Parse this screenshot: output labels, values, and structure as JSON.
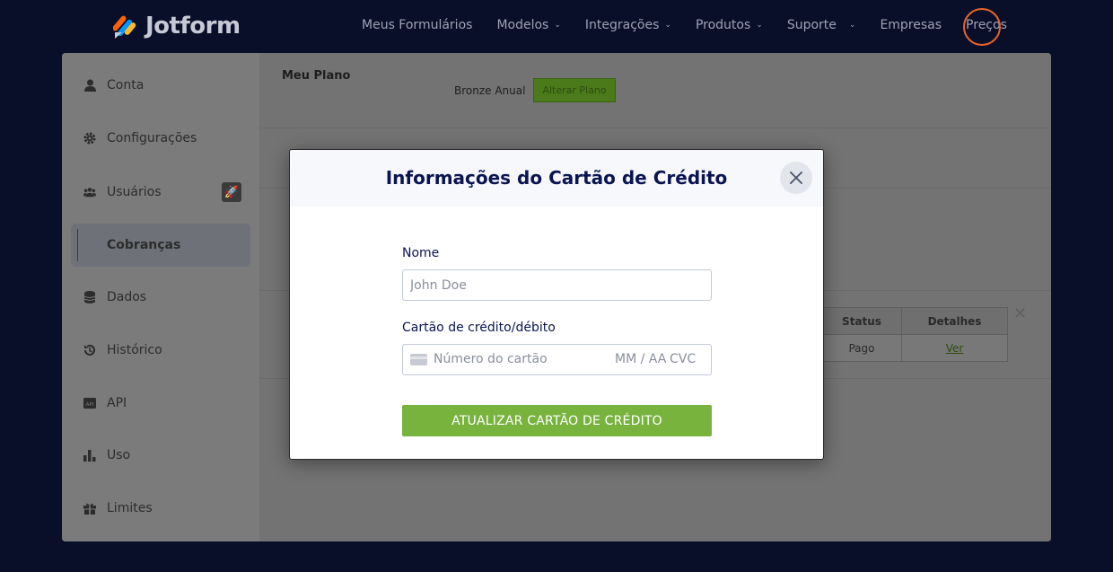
{
  "brand": {
    "name": "Jotform"
  },
  "nav": {
    "items": [
      {
        "label": "Meus Formulários",
        "has_dropdown": false
      },
      {
        "label": "Modelos",
        "has_dropdown": true
      },
      {
        "label": "Integrações",
        "has_dropdown": true
      },
      {
        "label": "Produtos",
        "has_dropdown": true
      },
      {
        "label": "Suporte",
        "has_dropdown": true
      },
      {
        "label": "Empresas",
        "has_dropdown": false
      },
      {
        "label": "Preços",
        "has_dropdown": false
      }
    ]
  },
  "sidebar": {
    "items": [
      {
        "label": "Conta",
        "icon": "user-icon"
      },
      {
        "label": "Configurações",
        "icon": "gear-icon"
      },
      {
        "label": "Usuários",
        "icon": "users-icon",
        "badge_icon": "rocket-icon"
      },
      {
        "label": "Cobranças",
        "icon": "billing-icon",
        "active": true
      },
      {
        "label": "Dados",
        "icon": "database-icon"
      },
      {
        "label": "Histórico",
        "icon": "history-icon"
      },
      {
        "label": "API",
        "icon": "api-icon"
      },
      {
        "label": "Uso",
        "icon": "bar-chart-icon"
      },
      {
        "label": "Limites",
        "icon": "gift-icon"
      }
    ]
  },
  "content": {
    "plan_label": "Meu Plano",
    "plan_value": "Bronze Anual",
    "change_plan_button": "Alterar Plano",
    "table": {
      "headers": [
        "Status",
        "Detalhes"
      ],
      "row": {
        "status": "Pago",
        "details_link": "Ver"
      }
    }
  },
  "modal": {
    "title": "Informações do Cartão de Crédito",
    "name_label": "Nome",
    "name_placeholder": "John Doe",
    "card_label": "Cartão de crédito/débito",
    "card_number_placeholder": "Número do cartão",
    "card_expiry_placeholder": "MM / AA",
    "card_cvc_placeholder": "CVC",
    "submit_label": "ATUALIZAR CARTÃO DE CRÉDITO"
  },
  "colors": {
    "background": "#0a0f29",
    "accent_green": "#78b33e",
    "title_navy": "#0a1551",
    "avatar_ring": "#e8632b"
  }
}
